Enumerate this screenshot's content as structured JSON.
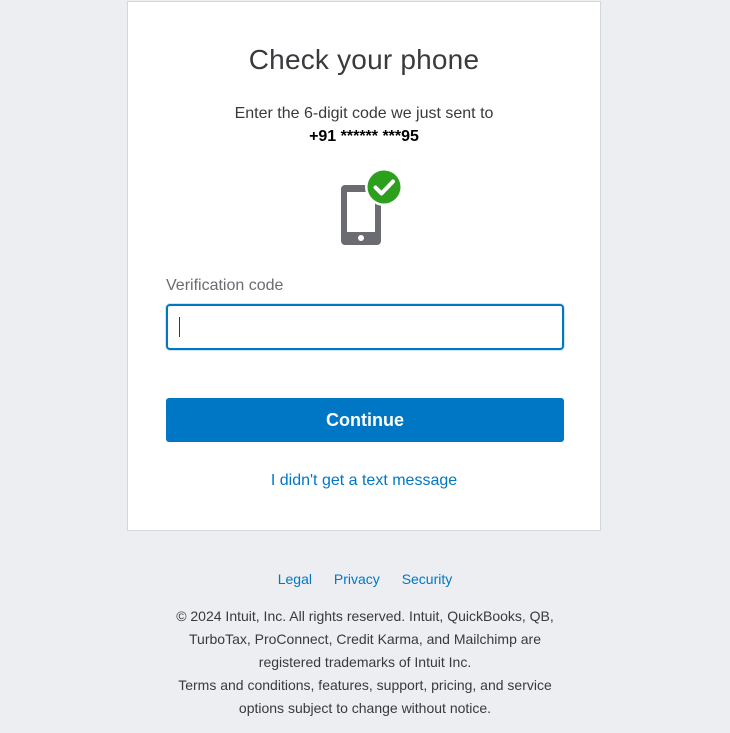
{
  "card": {
    "title": "Check your phone",
    "subtitle": "Enter the 6-digit code we just sent to",
    "phone_number": "+91 ****** ***95",
    "phone_icon": "phone-check-icon",
    "field_label": "Verification code",
    "code_value": "",
    "continue_label": "Continue",
    "no_text_link": "I didn't get a text message"
  },
  "footer": {
    "links": {
      "legal": "Legal",
      "privacy": "Privacy",
      "security": "Security"
    },
    "legal_lines": [
      "© 2024 Intuit, Inc. All rights reserved. Intuit, QuickBooks, QB,",
      "TurboTax, ProConnect, Credit Karma, and Mailchimp are",
      "registered trademarks of Intuit Inc.",
      "Terms and conditions, features, support, pricing, and service",
      "options subject to change without notice."
    ]
  },
  "colors": {
    "accent": "#0077c5",
    "success": "#2ca01c",
    "background": "#eceef1"
  }
}
